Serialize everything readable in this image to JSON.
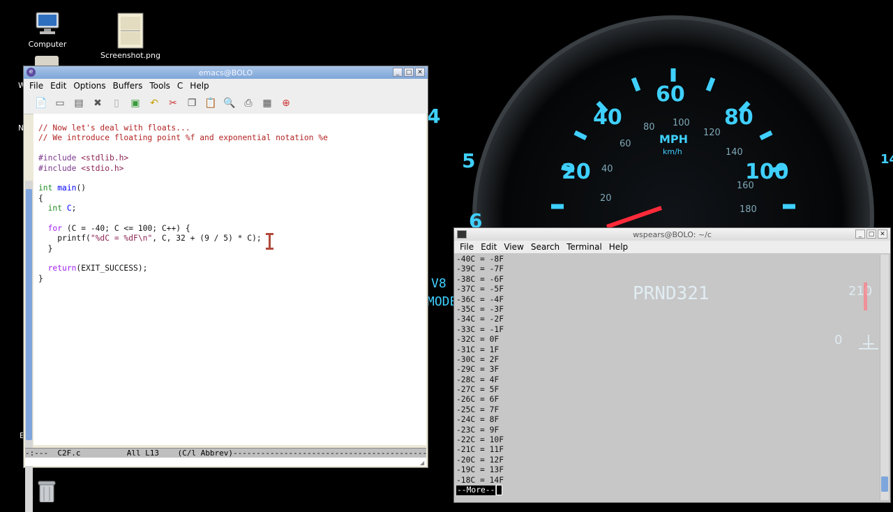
{
  "desktop": {
    "icons": [
      {
        "label": "Computer"
      },
      {
        "label": "Screenshot.png"
      }
    ],
    "edge_letters": [
      "W",
      "N",
      "E"
    ],
    "wallpaper": {
      "speed_numbers": [
        "20",
        "40",
        "60",
        "80",
        "100"
      ],
      "small_numbers": [
        "40",
        "60",
        "80",
        "100",
        "120",
        "140",
        "160",
        "180",
        "20"
      ],
      "outer_numbers": [
        "4",
        "5",
        "6",
        "14"
      ],
      "unit_top": "MPH",
      "unit_bottom": "km/h",
      "gear": "PRND321",
      "left_text": [
        "V8",
        "MODE"
      ],
      "temp": [
        "210",
        "0"
      ]
    }
  },
  "emacs": {
    "title": "emacs@BOLO",
    "menu": [
      "File",
      "Edit",
      "Options",
      "Buffers",
      "Tools",
      "C",
      "Help"
    ],
    "toolbar_icons": [
      "new-file-icon",
      "open-folder-icon",
      "dired-icon",
      "close-icon",
      "save-icon",
      "save-as-icon",
      "undo-icon",
      "cut-icon",
      "copy-icon",
      "paste-icon",
      "search-icon",
      "print-icon",
      "preferences-icon",
      "help-icon"
    ],
    "code": {
      "l1": "// Now let's deal with floats...",
      "l2": "// We introduce floating point %f and exponential notation %e",
      "inc1_kw": "#include",
      "inc1_file": " <stdlib.h>",
      "inc2_kw": "#include",
      "inc2_file": " <stdio.h>",
      "main_type": "int",
      "main_name": "main",
      "main_rest": "()",
      "open_brace": "{",
      "decl_type": "int",
      "decl_var": "C",
      "decl_end": ";",
      "for_kw": "for",
      "for_rest": " (C = -40; C <= 100; C++) {",
      "printf_pre": "printf(",
      "printf_str": "\"%dC = %dF\\n\"",
      "printf_post": ", C, 32 + (9 / 5) * C);",
      "inner_close": "}",
      "return_kw": "return",
      "return_rest": "(EXIT_SUCCESS);",
      "close_brace": "}"
    },
    "modeline": "-:---  C2F.c          All L13    (C/l Abbrev)--------------------------------------------"
  },
  "terminal": {
    "title": "wspears@BOLO: ~/c",
    "menu": [
      "File",
      "Edit",
      "View",
      "Search",
      "Terminal",
      "Help"
    ],
    "lines": [
      "-40C = -8F",
      "-39C = -7F",
      "-38C = -6F",
      "-37C = -5F",
      "-36C = -4F",
      "-35C = -3F",
      "-34C = -2F",
      "-33C = -1F",
      "-32C = 0F",
      "-31C = 1F",
      "-30C = 2F",
      "-29C = 3F",
      "-28C = 4F",
      "-27C = 5F",
      "-26C = 6F",
      "-25C = 7F",
      "-24C = 8F",
      "-23C = 9F",
      "-22C = 10F",
      "-21C = 11F",
      "-20C = 12F",
      "-19C = 13F",
      "-18C = 14F"
    ],
    "more": "--More--"
  }
}
